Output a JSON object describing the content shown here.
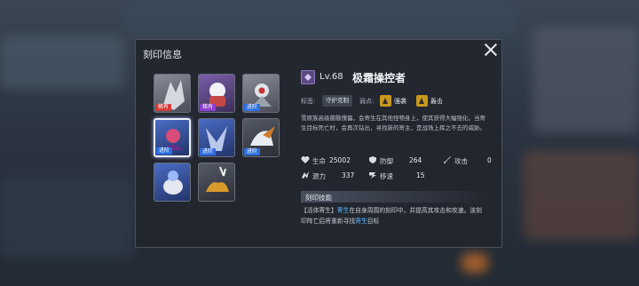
{
  "panel": {
    "title": "刻印信息"
  },
  "grid": [
    {
      "badge": "稀有",
      "badge_color": "red",
      "tone": "gray",
      "selected": false
    },
    {
      "badge": "稀有",
      "badge_color": "purple",
      "tone": "purple",
      "selected": false
    },
    {
      "badge": "进阶",
      "badge_color": "blue",
      "tone": "gray",
      "selected": false
    },
    {
      "badge": "进阶",
      "badge_color": "blue",
      "tone": "blue",
      "selected": true
    },
    {
      "badge": "进阶",
      "badge_color": "blue",
      "tone": "blue",
      "selected": false
    },
    {
      "badge": "进阶",
      "badge_color": "blue",
      "tone": "dark",
      "selected": false
    },
    {
      "badge": "",
      "badge_color": "",
      "tone": "blue",
      "selected": false
    },
    {
      "badge": "",
      "badge_color": "",
      "tone": "dark",
      "selected": false
    }
  ],
  "detail": {
    "level": "Lv.68",
    "name": "极霜操控者",
    "tag_label": "标签:",
    "tag": "守护克制",
    "weak_label": "弱点:",
    "weak1": "强袭",
    "weak2": "轰击",
    "description": "雪原族高级菌骸傀儡，会寄生在其他怪物身上，使其获得大幅强化。当寄生目标死亡时，会再次钻出，寻找新的寄主，是战场上挥之不去的威胁。"
  },
  "stats": {
    "hp_label": "生命",
    "hp": "25002",
    "def_label": "防御",
    "def": "264",
    "atk_label": "攻击",
    "atk": "0",
    "src_label": "源力",
    "src": "337",
    "spd_label": "移速",
    "spd": "15"
  },
  "skill": {
    "header": "刻印技能",
    "bracket": "【活体寄生】",
    "p1": "寄生",
    "p2": "在自身周围的刻印中，并提高其攻击和攻速。该刻印阵亡后将重新寻找",
    "p3": "寄生",
    "p4": "目标"
  },
  "colors": {
    "highlight": "#5ab6ff",
    "weak_icon": "#c7981e",
    "panel_bg": "#22262e"
  }
}
